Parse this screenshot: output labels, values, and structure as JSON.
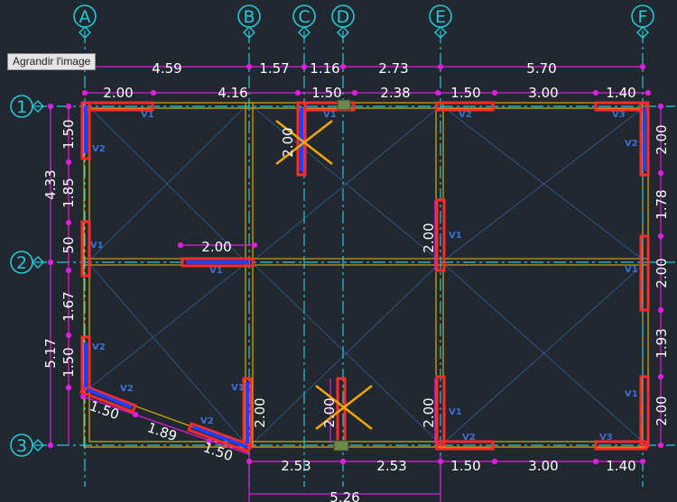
{
  "tooltip": "Agrandir l'image",
  "grid": {
    "columns": [
      "A",
      "B",
      "C",
      "D",
      "E",
      "F"
    ],
    "rows": [
      "1",
      "2",
      "3"
    ]
  },
  "dimensions": {
    "top_overall": [
      "4.59",
      "1.57",
      "1.16",
      "2.73",
      "5.70"
    ],
    "top_detail": [
      "2.00",
      "4.16",
      "1.50",
      "2.38",
      "1.50",
      "3.00",
      "1.40"
    ],
    "left_overall": [
      "4.33",
      "5.17"
    ],
    "left_detail": [
      "1.50",
      "1.85",
      "50",
      "1.67",
      "1.50"
    ],
    "right": [
      "2.00",
      "1.78",
      "2.00",
      "1.93",
      "2.00"
    ],
    "bottom_detail": [
      "2.53",
      "2.53",
      "1.50",
      "3.00",
      "1.40"
    ],
    "bottom_total": "5.26",
    "diagonal": [
      "1.50",
      "1.89",
      "1.50"
    ],
    "interior": [
      "2.00",
      "2.00",
      "2.00",
      "2.00",
      "2.00"
    ]
  },
  "wall_tags": {
    "v1": "V1",
    "v2": "V2",
    "v3": "V3"
  },
  "colors": {
    "background": "#212830",
    "grid_line": "#27c8d6",
    "dimension": "#e01ee0",
    "beam": "#e8b800",
    "wall_red": "#ff2a2a",
    "wall_blue": "#2040ff",
    "cross": "#f2a800",
    "slab_hatch": "#3a6fb0"
  }
}
